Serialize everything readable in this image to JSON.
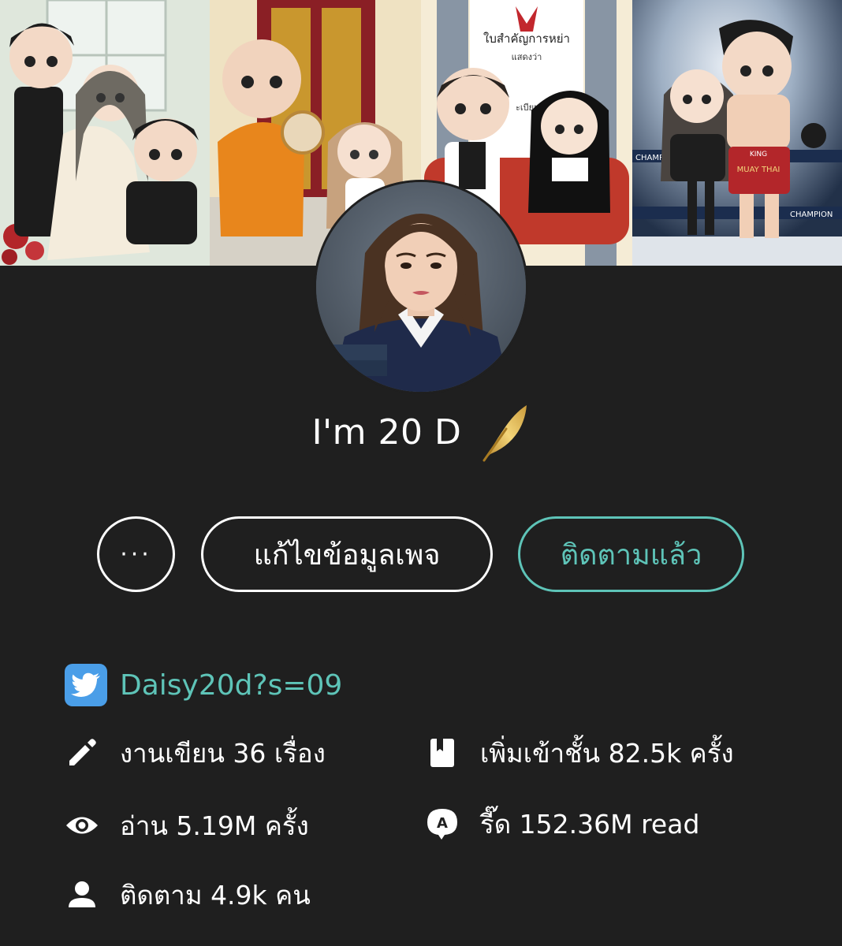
{
  "cover": {
    "panels": [
      {
        "name": "cover-panel-1",
        "palette": "#d8e2d6"
      },
      {
        "name": "cover-panel-2",
        "palette": "#e8d4a8"
      },
      {
        "name": "cover-panel-3",
        "palette": "#efe4c8"
      },
      {
        "name": "cover-panel-4",
        "palette": "#2b3a52"
      }
    ],
    "doc_title": "ใบสำคัญการหย่า",
    "doc_subtitle": "แสดงว่า",
    "doc_fragment": "ะเบียน",
    "champion_text": "CHAMPION",
    "shorts_text": "KING",
    "shorts_text_2": "MUAY THAI"
  },
  "profile": {
    "name": "I'm 20 D",
    "badge_icon": "gold-feather-icon"
  },
  "actions": {
    "more_label": "···",
    "edit_label": "แก้ไขข้อมูลเพจ",
    "follow_label": "ติดตามแล้ว"
  },
  "social": {
    "platform_icon": "twitter-icon",
    "handle": "Daisy20d?s=09"
  },
  "stats": {
    "works": "งานเขียน 36 เรื่อง",
    "library": "เพิ่มเข้าชั้น 82.5k ครั้ง",
    "reads": "อ่าน 5.19M ครั้ง",
    "read_total": "รี๊ด 152.36M read",
    "followers": "ติดตาม 4.9k คน"
  },
  "colors": {
    "background": "#1f1f1f",
    "accent": "#5ec4b8",
    "twitter": "#4a9ee8",
    "text": "#ffffff"
  }
}
